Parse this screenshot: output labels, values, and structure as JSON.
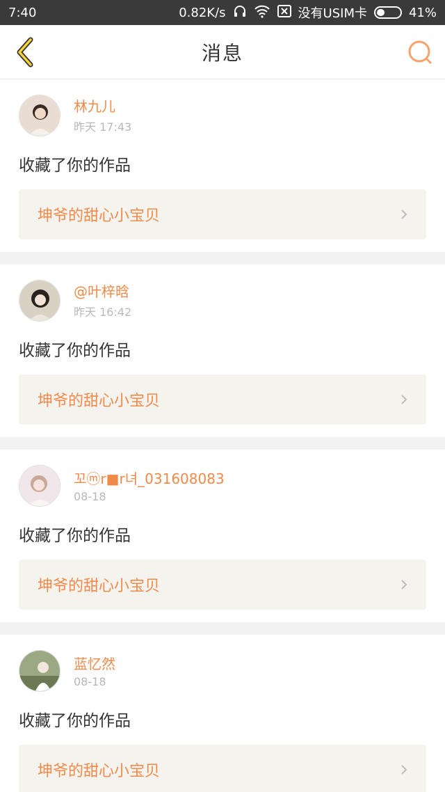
{
  "status_bar": {
    "time": "7:40",
    "speed": "0.82K/s",
    "sim": "没有USIM卡",
    "battery_percent": "41%",
    "battery_level": 0.41,
    "icons": [
      "headphones-icon",
      "wifi-icon",
      "sim-x-icon",
      "battery-icon"
    ]
  },
  "nav": {
    "title": "消息",
    "back_icon": "chevron-left-icon",
    "search_icon": "search-icon",
    "accent_color": "#f5a623"
  },
  "messages": [
    {
      "user": "林九儿",
      "time": "昨天 17:43",
      "action": "收藏了你的作品",
      "work_title": "坤爷的甜心小宝贝"
    },
    {
      "user": "@叶梓晗",
      "time": "昨天 16:42",
      "action": "收藏了你的作品",
      "work_title": "坤爷的甜心小宝贝"
    },
    {
      "user": "꼬ⓜr■r녀_031608083",
      "time": "08-18",
      "action": "收藏了你的作品",
      "work_title": "坤爷的甜心小宝贝"
    },
    {
      "user": "蓝忆然",
      "time": "08-18",
      "action": "收藏了你的作品",
      "work_title": "坤爷的甜心小宝贝"
    }
  ],
  "colors": {
    "name": "#f08a4b",
    "time": "#b8b8b8",
    "link_bg": "#f4f3ee"
  }
}
